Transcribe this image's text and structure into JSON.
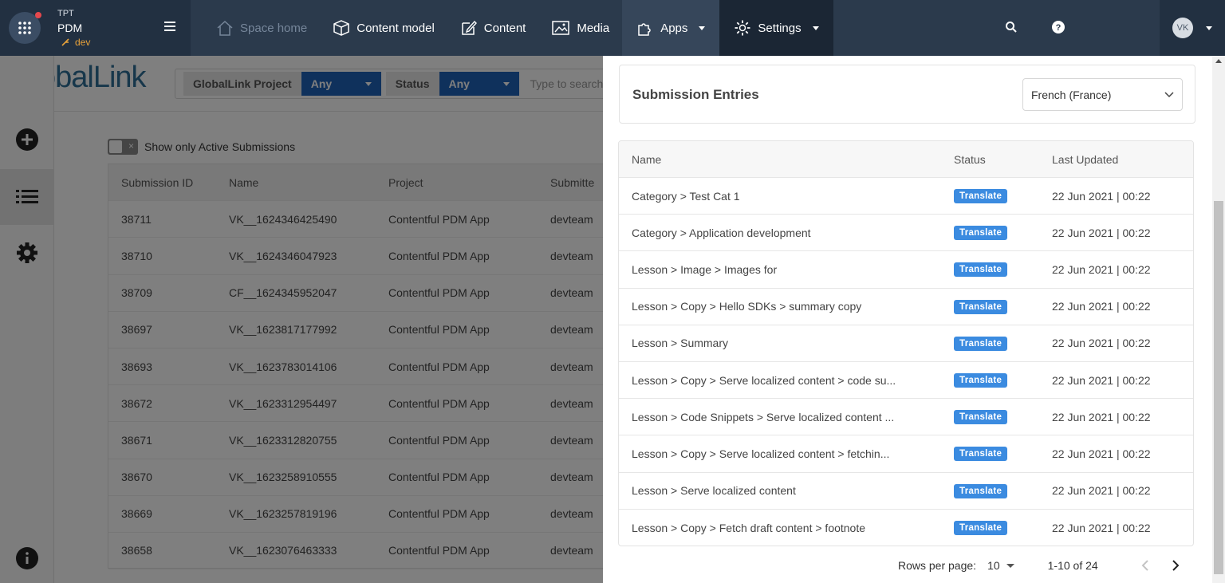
{
  "topnav": {
    "org": "TPT",
    "space": "PDM",
    "environment": "dev",
    "items": [
      {
        "label": "Space home",
        "icon": "home-icon"
      },
      {
        "label": "Content model",
        "icon": "box-icon"
      },
      {
        "label": "Content",
        "icon": "edit-icon"
      },
      {
        "label": "Media",
        "icon": "image-icon"
      },
      {
        "label": "Apps",
        "icon": "puzzle-icon"
      },
      {
        "label": "Settings",
        "icon": "gear-icon"
      }
    ],
    "avatar_initials": "VK"
  },
  "app": {
    "logo": "GlobalLink",
    "filter": {
      "project_label": "GlobalLink Project",
      "project_value": "Any",
      "status_label": "Status",
      "status_value": "Any",
      "search_placeholder": "Type to search fo"
    },
    "toggle_label": "Show only Active Submissions",
    "table": {
      "headers": [
        "Submission ID",
        "Name",
        "Project",
        "Submitte"
      ],
      "rows": [
        [
          "38711",
          "VK__1624346425490",
          "Contentful PDM App",
          "devteam"
        ],
        [
          "38710",
          "VK__1624346047923",
          "Contentful PDM App",
          "devteam"
        ],
        [
          "38709",
          "CF__1624345952047",
          "Contentful PDM App",
          "devteam"
        ],
        [
          "38697",
          "VK__1623817177992",
          "Contentful PDM App",
          "devteam"
        ],
        [
          "38693",
          "VK__1623783014106",
          "Contentful PDM App",
          "devteam"
        ],
        [
          "38672",
          "VK__1623312954497",
          "Contentful PDM App",
          "devteam"
        ],
        [
          "38671",
          "VK__1623312820755",
          "Contentful PDM App",
          "devteam"
        ],
        [
          "38670",
          "VK__1623258910555",
          "Contentful PDM App",
          "devteam"
        ],
        [
          "38669",
          "VK__1623257819196",
          "Contentful PDM App",
          "devteam"
        ],
        [
          "38658",
          "VK__1623076463333",
          "Contentful PDM App",
          "devteam"
        ]
      ]
    }
  },
  "drawer": {
    "title": "Submission Entries",
    "language": "French (France)",
    "columns": {
      "name": "Name",
      "status": "Status",
      "updated": "Last Updated"
    },
    "entries": [
      {
        "name": "Category > Test Cat 1",
        "status": "Translate",
        "updated": "22 Jun 2021 | 00:22"
      },
      {
        "name": "Category > Application development",
        "status": "Translate",
        "updated": "22 Jun 2021 | 00:22"
      },
      {
        "name": "Lesson > Image > Images for",
        "status": "Translate",
        "updated": "22 Jun 2021 | 00:22"
      },
      {
        "name": "Lesson > Copy > Hello SDKs > summary copy",
        "status": "Translate",
        "updated": "22 Jun 2021 | 00:22"
      },
      {
        "name": "Lesson > Summary",
        "status": "Translate",
        "updated": "22 Jun 2021 | 00:22"
      },
      {
        "name": "Lesson > Copy > Serve localized content > code su...",
        "status": "Translate",
        "updated": "22 Jun 2021 | 00:22"
      },
      {
        "name": "Lesson > Code Snippets > Serve localized content ...",
        "status": "Translate",
        "updated": "22 Jun 2021 | 00:22"
      },
      {
        "name": "Lesson > Copy > Serve localized content > fetchin...",
        "status": "Translate",
        "updated": "22 Jun 2021 | 00:22"
      },
      {
        "name": "Lesson > Serve localized content",
        "status": "Translate",
        "updated": "22 Jun 2021 | 00:22"
      },
      {
        "name": "Lesson > Copy > Fetch draft content > footnote",
        "status": "Translate",
        "updated": "22 Jun 2021 | 00:22"
      }
    ],
    "pagination": {
      "rows_per_page_label": "Rows per page:",
      "rows_per_page": "10",
      "range": "1-10 of 24"
    }
  }
}
